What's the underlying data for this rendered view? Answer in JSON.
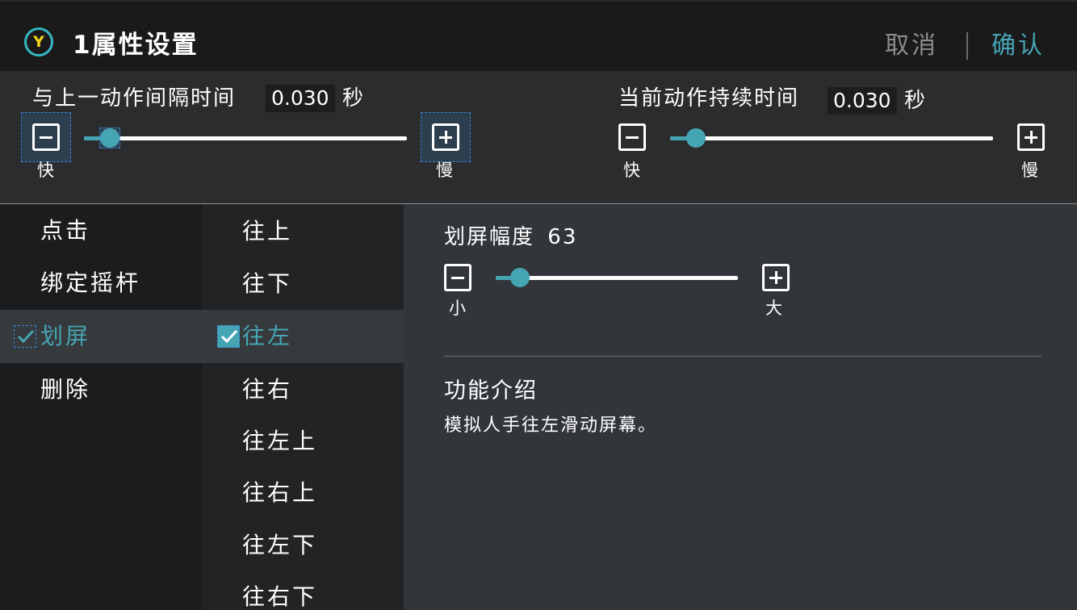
{
  "header": {
    "badge": "Y",
    "title": "1属性设置",
    "cancel_label": "取消",
    "confirm_label": "确认"
  },
  "interval": {
    "label": "与上一动作间隔时间",
    "value": "0.030",
    "unit": "秒",
    "min_caption": "快",
    "max_caption": "慢",
    "level": 0.08
  },
  "duration": {
    "label": "当前动作持续时间",
    "value": "0.030",
    "unit": "秒",
    "min_caption": "快",
    "max_caption": "慢",
    "level": 0.08
  },
  "actions": {
    "items": [
      {
        "label": "点击",
        "selected": false
      },
      {
        "label": "绑定摇杆",
        "selected": false
      },
      {
        "label": "划屏",
        "selected": true
      },
      {
        "label": "删除",
        "selected": false
      }
    ]
  },
  "directions": {
    "items": [
      {
        "label": "往上",
        "selected": false
      },
      {
        "label": "往下",
        "selected": false
      },
      {
        "label": "往左",
        "selected": true
      },
      {
        "label": "往右",
        "selected": false
      },
      {
        "label": "往左上",
        "selected": false
      },
      {
        "label": "往右上",
        "selected": false
      },
      {
        "label": "往左下",
        "selected": false
      },
      {
        "label": "往右下",
        "selected": false
      }
    ]
  },
  "swipe": {
    "label": "划屏幅度",
    "value": "63",
    "min_caption": "小",
    "max_caption": "大",
    "level": 0.1
  },
  "info": {
    "heading": "功能介绍",
    "description": "模拟人手往左滑动屏幕。"
  },
  "colors": {
    "accent": "#46a5b3",
    "badge_ring": "#36b8c4",
    "badge_letter": "#f2d21a",
    "selected_row": "#363a3d"
  }
}
